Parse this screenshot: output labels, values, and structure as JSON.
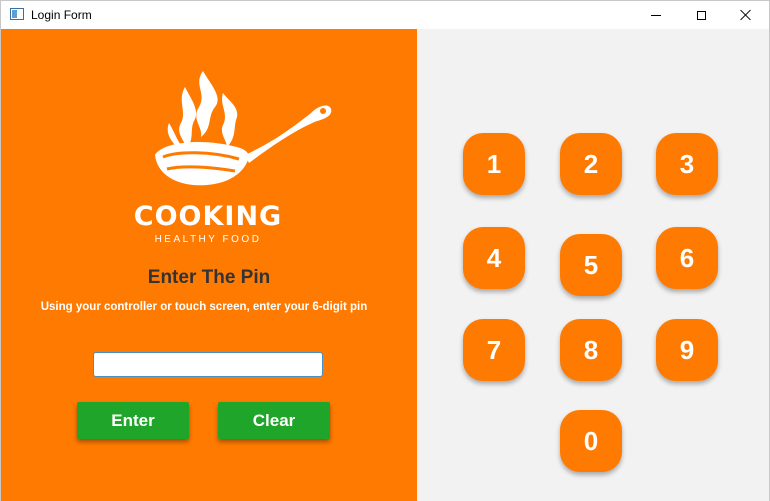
{
  "window": {
    "title": "Login Form"
  },
  "brand": {
    "name": "COOKING",
    "tagline": "HEALTHY FOOD",
    "accent_color": "#ff7a00"
  },
  "pin": {
    "heading": "Enter The Pin",
    "instructions": "Using your controller or touch screen, enter your 6-digit pin",
    "input_value": ""
  },
  "actions": {
    "enter_label": "Enter",
    "clear_label": "Clear",
    "button_color": "#1fa62a"
  },
  "keypad": {
    "keys": [
      "1",
      "2",
      "3",
      "4",
      "5",
      "6",
      "7",
      "8",
      "9",
      "0"
    ]
  },
  "icons": {
    "app": "app-window-icon",
    "logo": "flaming-pan-icon",
    "minimize": "minimize-icon",
    "maximize": "maximize-icon",
    "close": "close-icon"
  }
}
